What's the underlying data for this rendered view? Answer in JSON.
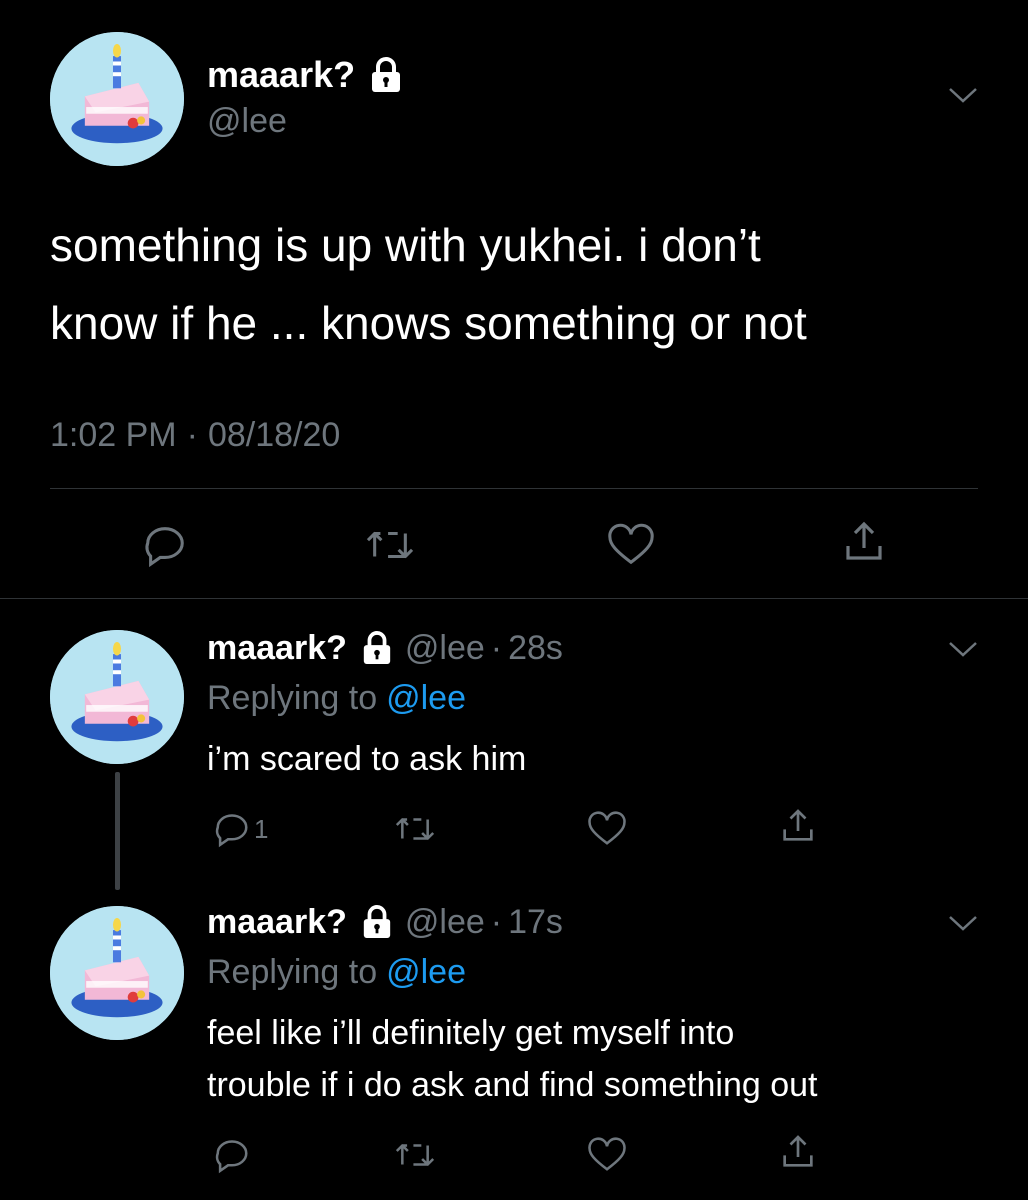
{
  "colors": {
    "background": "#000000",
    "text": "#ffffff",
    "muted": "#6e767d",
    "link": "#1d9bf0",
    "divider": "#2f3336",
    "avatar_bg": "#b8e4f2"
  },
  "main_tweet": {
    "display_name": "maaark?",
    "handle": "@lee",
    "text_line1": "something is up with yukhei. i don’t",
    "text_line2": "know if he ... knows something or not",
    "time": "1:02 PM",
    "separator": "·",
    "date": "08/18/20",
    "icons": [
      "reply-icon",
      "retweet-icon",
      "like-icon",
      "share-icon"
    ]
  },
  "replies": [
    {
      "display_name": "maaark?",
      "handle": "@lee",
      "separator": "·",
      "age": "28s",
      "replying_label": "Replying to",
      "replying_handle": "@lee",
      "text_line1": "i’m scared to ask him",
      "text_line2": "",
      "reply_count": "1"
    },
    {
      "display_name": "maaark?",
      "handle": "@lee",
      "separator": "·",
      "age": "17s",
      "replying_label": "Replying to",
      "replying_handle": "@lee",
      "text_line1": "feel like i’ll definitely get myself into",
      "text_line2": "trouble if i do ask and find something out",
      "reply_count": ""
    }
  ]
}
